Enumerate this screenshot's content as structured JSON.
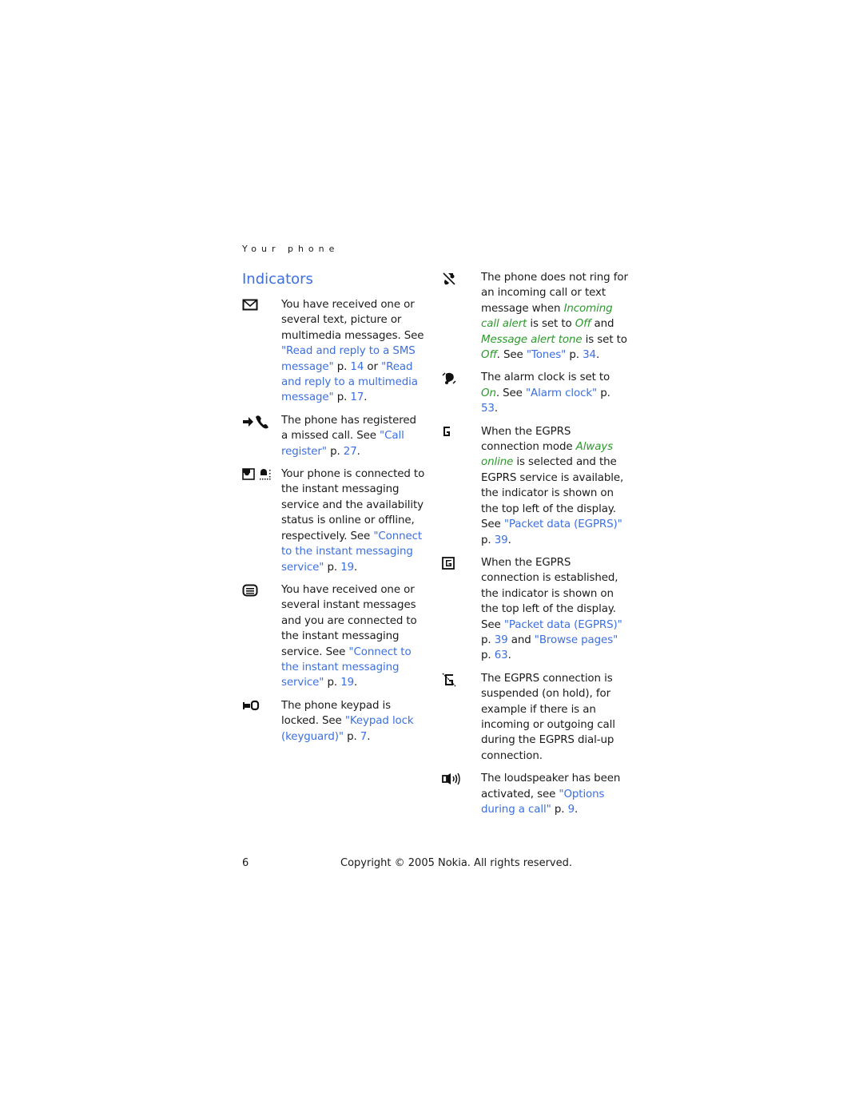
{
  "running_head": "Your phone",
  "section_title": "Indicators",
  "left_entries": [
    {
      "icon": "envelope-icon",
      "parts": [
        {
          "t": "text",
          "v": "You have received one or several text, picture or multimedia messages. See "
        },
        {
          "t": "link",
          "v": "\"Read and reply to a SMS message\""
        },
        {
          "t": "text",
          "v": " p. "
        },
        {
          "t": "link",
          "v": "14"
        },
        {
          "t": "text",
          "v": " or "
        },
        {
          "t": "link",
          "v": "\"Read and reply to a multimedia message\""
        },
        {
          "t": "text",
          "v": " p. "
        },
        {
          "t": "link",
          "v": "17"
        },
        {
          "t": "text",
          "v": "."
        }
      ]
    },
    {
      "icon": "missed-call-icon",
      "parts": [
        {
          "t": "text",
          "v": "The phone has registered a missed call. See "
        },
        {
          "t": "link",
          "v": "\"Call register\""
        },
        {
          "t": "text",
          "v": " p. "
        },
        {
          "t": "link",
          "v": "27"
        },
        {
          "t": "text",
          "v": "."
        }
      ]
    },
    {
      "icon": "im-online-offline-icon",
      "parts": [
        {
          "t": "text",
          "v": "Your phone is connected to the instant messaging service and the availability status is online or offline, respectively. See "
        },
        {
          "t": "link",
          "v": "\"Connect to the instant messaging service\""
        },
        {
          "t": "text",
          "v": " p. "
        },
        {
          "t": "link",
          "v": "19"
        },
        {
          "t": "text",
          "v": "."
        }
      ]
    },
    {
      "icon": "instant-message-icon",
      "parts": [
        {
          "t": "text",
          "v": "You have received one or several instant messages and you are connected to the instant messaging service. See "
        },
        {
          "t": "link",
          "v": "\"Connect to the instant messaging service\""
        },
        {
          "t": "text",
          "v": " p. "
        },
        {
          "t": "link",
          "v": "19"
        },
        {
          "t": "text",
          "v": "."
        }
      ]
    },
    {
      "icon": "keypad-lock-icon",
      "parts": [
        {
          "t": "text",
          "v": "The phone keypad is locked. See "
        },
        {
          "t": "link",
          "v": "\"Keypad lock (keyguard)\""
        },
        {
          "t": "text",
          "v": " p. "
        },
        {
          "t": "link",
          "v": "7"
        },
        {
          "t": "text",
          "v": "."
        }
      ]
    }
  ],
  "right_entries": [
    {
      "icon": "silent-icon",
      "parts": [
        {
          "t": "text",
          "v": "The phone does not ring for an incoming call or text message when "
        },
        {
          "t": "ital",
          "v": "Incoming call alert"
        },
        {
          "t": "text",
          "v": " is set to "
        },
        {
          "t": "ital",
          "v": "Off"
        },
        {
          "t": "text",
          "v": " and "
        },
        {
          "t": "ital",
          "v": "Message alert tone"
        },
        {
          "t": "text",
          "v": " is set to "
        },
        {
          "t": "ital",
          "v": "Off"
        },
        {
          "t": "text",
          "v": ". See "
        },
        {
          "t": "link",
          "v": "\"Tones\""
        },
        {
          "t": "text",
          "v": " p. "
        },
        {
          "t": "link",
          "v": "34"
        },
        {
          "t": "text",
          "v": "."
        }
      ]
    },
    {
      "icon": "alarm-clock-icon",
      "parts": [
        {
          "t": "text",
          "v": "The alarm clock is set to "
        },
        {
          "t": "ital",
          "v": "On"
        },
        {
          "t": "text",
          "v": ". See "
        },
        {
          "t": "link",
          "v": "\"Alarm clock\""
        },
        {
          "t": "text",
          "v": " p. "
        },
        {
          "t": "link",
          "v": "53"
        },
        {
          "t": "text",
          "v": "."
        }
      ]
    },
    {
      "icon": "egprs-available-icon",
      "parts": [
        {
          "t": "text",
          "v": "When the EGPRS connection mode "
        },
        {
          "t": "ital",
          "v": "Always online"
        },
        {
          "t": "text",
          "v": " is selected and the EGPRS service is available, the indicator is shown on the top left of the display. See "
        },
        {
          "t": "link",
          "v": "\"Packet data (EGPRS)\""
        },
        {
          "t": "text",
          "v": " p. "
        },
        {
          "t": "link",
          "v": "39"
        },
        {
          "t": "text",
          "v": "."
        }
      ]
    },
    {
      "icon": "egprs-connected-icon",
      "parts": [
        {
          "t": "text",
          "v": "When the EGPRS connection is established, the indicator is shown on the top left of the display. See "
        },
        {
          "t": "link",
          "v": "\"Packet data (EGPRS)\""
        },
        {
          "t": "text",
          "v": " p. "
        },
        {
          "t": "link",
          "v": "39"
        },
        {
          "t": "text",
          "v": " and "
        },
        {
          "t": "link",
          "v": "\"Browse pages\""
        },
        {
          "t": "text",
          "v": " p. "
        },
        {
          "t": "link",
          "v": "63"
        },
        {
          "t": "text",
          "v": "."
        }
      ]
    },
    {
      "icon": "egprs-suspended-icon",
      "parts": [
        {
          "t": "text",
          "v": "The EGPRS connection is suspended (on hold), for example if there is an incoming or outgoing call during the EGPRS dial-up connection."
        }
      ]
    },
    {
      "icon": "loudspeaker-icon",
      "parts": [
        {
          "t": "text",
          "v": "The loudspeaker has been activated, see "
        },
        {
          "t": "link",
          "v": "\"Options during a call\""
        },
        {
          "t": "text",
          "v": " p. "
        },
        {
          "t": "link",
          "v": "9"
        },
        {
          "t": "text",
          "v": "."
        }
      ]
    }
  ],
  "footer": {
    "page_number": "6",
    "copyright": "Copyright © 2005 Nokia. All rights reserved."
  },
  "colors": {
    "link": "#3b6fe0",
    "menu_term": "#2a9a2a"
  }
}
